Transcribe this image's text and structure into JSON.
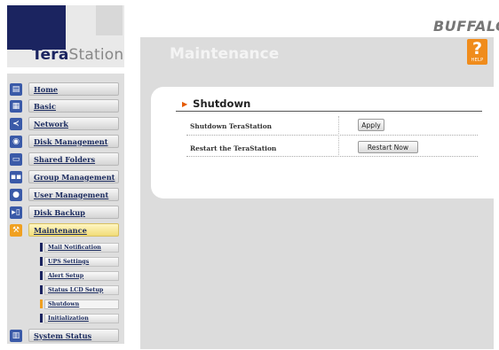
{
  "logo": {
    "brand_part1": "Tera",
    "brand_part2": "Station"
  },
  "brand": "BUFFALO",
  "sidebar": {
    "items": [
      {
        "label": "Home",
        "icon": "home-icon",
        "color": "#3a5aa8"
      },
      {
        "label": "Basic",
        "icon": "basic-icon",
        "color": "#3a5aa8"
      },
      {
        "label": "Network",
        "icon": "network-icon",
        "color": "#3a5aa8"
      },
      {
        "label": "Disk Management",
        "icon": "disk-management-icon",
        "color": "#3a5aa8"
      },
      {
        "label": "Shared Folders",
        "icon": "shared-folders-icon",
        "color": "#3a5aa8"
      },
      {
        "label": "Group Management",
        "icon": "group-management-icon",
        "color": "#3a5aa8"
      },
      {
        "label": "User Management",
        "icon": "user-management-icon",
        "color": "#3a5aa8"
      },
      {
        "label": "Disk Backup",
        "icon": "disk-backup-icon",
        "color": "#3a5aa8"
      },
      {
        "label": "Maintenance",
        "icon": "maintenance-icon",
        "color": "#f0a020",
        "active": true
      },
      {
        "label": "System Status",
        "icon": "system-status-icon",
        "color": "#3a5aa8"
      }
    ],
    "subitems": [
      {
        "label": "Mail Notification"
      },
      {
        "label": "UPS Settings"
      },
      {
        "label": "Alert Setup"
      },
      {
        "label": "Status LCD Setup"
      },
      {
        "label": "Shutdown",
        "active": true
      },
      {
        "label": "Initialization"
      }
    ]
  },
  "main": {
    "title": "Maintenance",
    "help": {
      "symbol": "?",
      "label": "HELP"
    },
    "section": {
      "title": "Shutdown",
      "rows": [
        {
          "label": "Shutdown TeraStation",
          "button": "Apply"
        },
        {
          "label": "Restart the TeraStation",
          "button": "Restart Now"
        }
      ]
    }
  },
  "colors": {
    "accent": "#f08c1c",
    "navy": "#1b2460",
    "active_nav": "#f1dc78"
  }
}
